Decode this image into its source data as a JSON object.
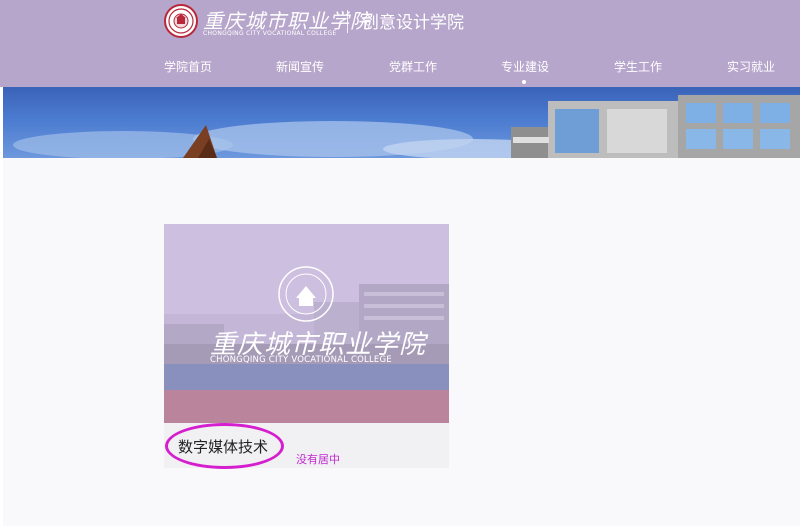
{
  "header": {
    "brand_cn": "重庆城市职业学院",
    "brand_en": "CHONGQING CITY VOCATIONAL COLLEGE",
    "school_name": "创意设计学院"
  },
  "nav": {
    "items": [
      {
        "label": "学院首页"
      },
      {
        "label": "新闻宣传"
      },
      {
        "label": "党群工作"
      },
      {
        "label": "专业建设",
        "active": true
      },
      {
        "label": "学生工作"
      },
      {
        "label": "实习就业"
      }
    ]
  },
  "card": {
    "image_brand_cn": "重庆城市职业学院",
    "image_brand_en": "CHONGQING CITY VOCATIONAL COLLEGE",
    "title": "数字媒体技术",
    "annotation": "没有居中"
  },
  "colors": {
    "header_bg": "#b7a6cb",
    "annotation": "#d51fcf"
  }
}
